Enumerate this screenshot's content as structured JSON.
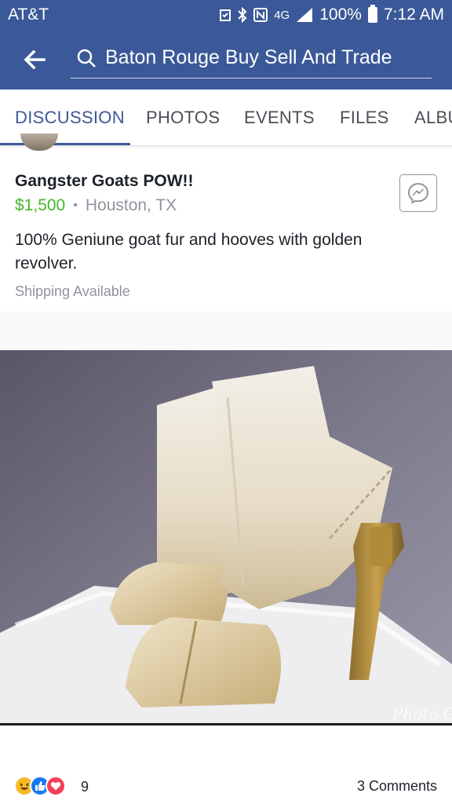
{
  "status_bar": {
    "carrier": "AT&T",
    "network": "4G",
    "battery": "100%",
    "time": "7:12 AM",
    "icons": [
      "alarm-icon",
      "bluetooth-icon",
      "nfc-icon",
      "lte-icon",
      "signal-icon",
      "battery-icon"
    ]
  },
  "search": {
    "query": "Baton Rouge Buy Sell And Trade"
  },
  "tabs": [
    {
      "label": "DISCUSSION",
      "active": true
    },
    {
      "label": "PHOTOS",
      "active": false
    },
    {
      "label": "EVENTS",
      "active": false
    },
    {
      "label": "FILES",
      "active": false
    },
    {
      "label": "ALBU",
      "active": false
    }
  ],
  "post": {
    "title": "Gangster Goats POW!!",
    "price": "$1,500",
    "separator": "•",
    "location": "Houston, TX",
    "description": "100% Geniune goat fur and hooves with golden revolver.",
    "shipping": "Shipping Available",
    "watermark": "Photo Grid"
  },
  "reactions": {
    "types": [
      "haha-icon",
      "like-icon",
      "love-icon"
    ],
    "count": "9",
    "comments": "3 Comments"
  },
  "colors": {
    "brand": "#3b5998",
    "price_green": "#42b72a",
    "muted": "#90949c"
  }
}
